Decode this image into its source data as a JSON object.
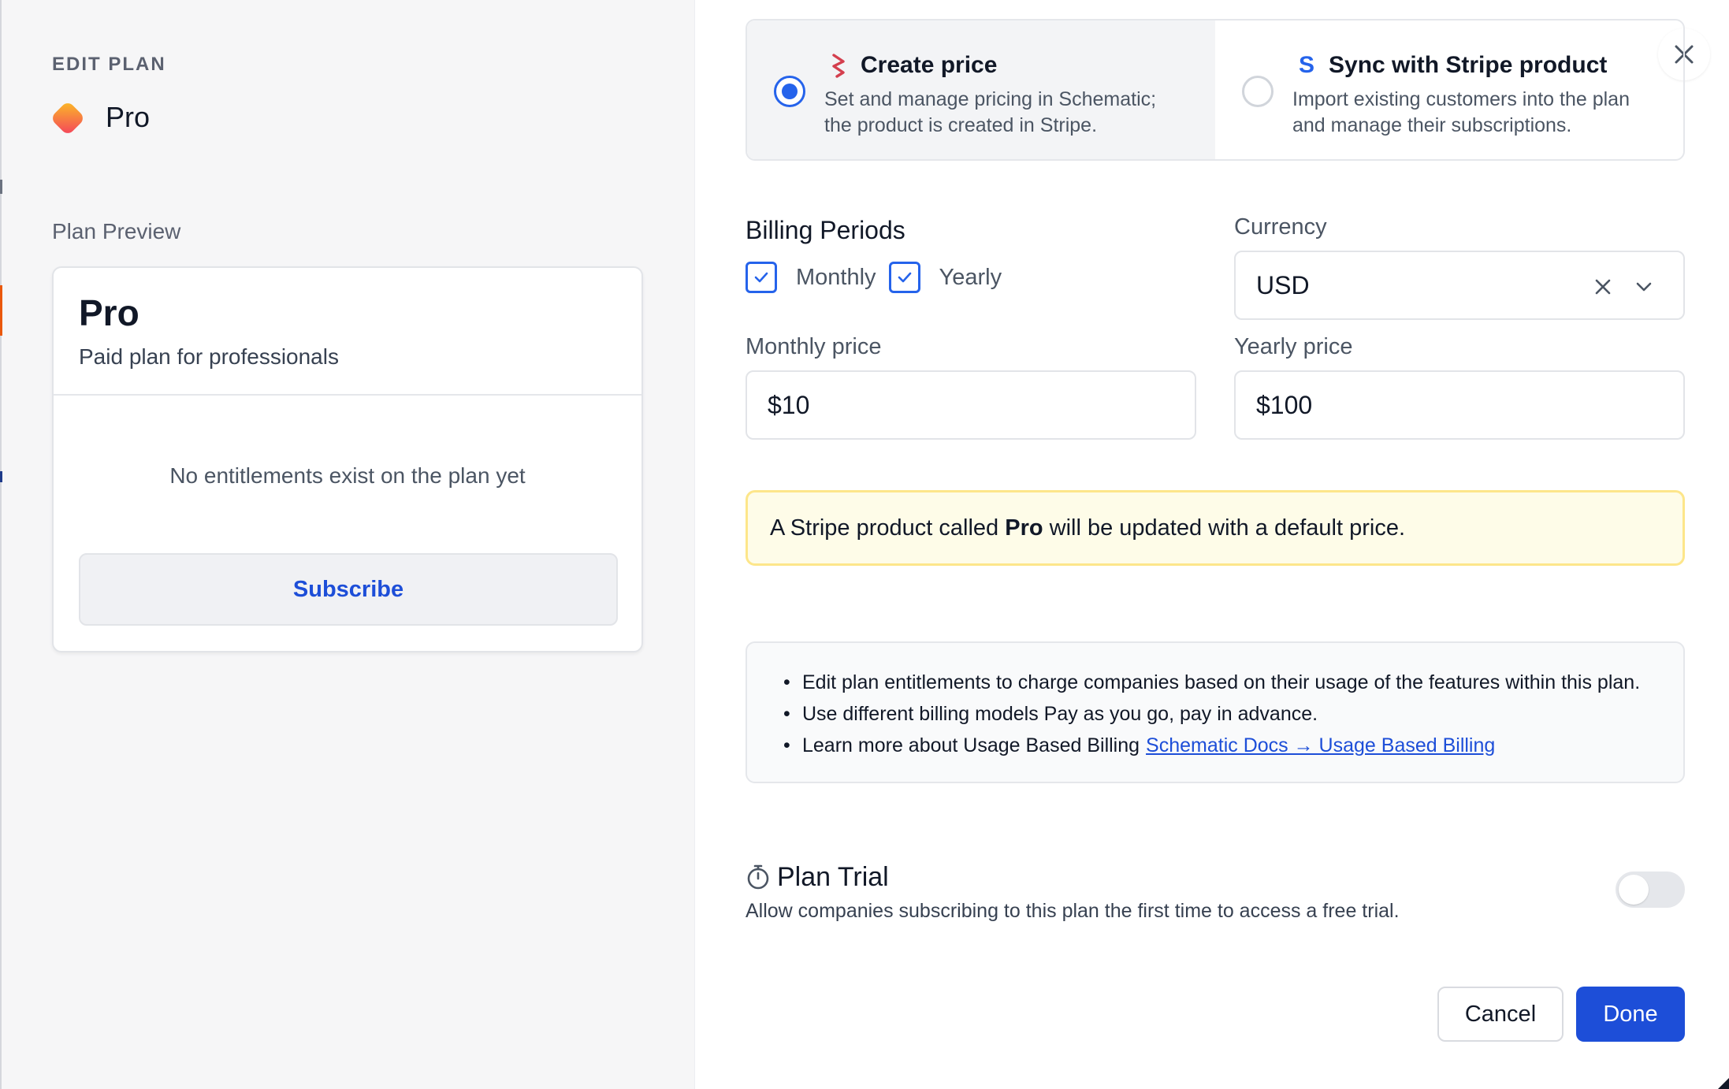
{
  "colors": {
    "accent": "#1d4ed8",
    "radio_selected": "#2563eb",
    "notice_bg": "#fefce8",
    "notice_border": "#fde68a",
    "left_panel_bg": "#f6f6f7",
    "stripe_icon": "#d43f4e",
    "sync_icon": "#2563eb"
  },
  "sidebar": {
    "header": "EDIT PLAN",
    "plan_name": "Pro",
    "plan_icon": "orange-gradient-rounded-square-icon",
    "preview_label": "Plan Preview",
    "preview_card": {
      "title": "Pro",
      "subtitle": "Paid plan for professionals",
      "empty_text": "No entitlements exist on the plan yet",
      "button_label": "Subscribe"
    }
  },
  "close_icon": "close-icon",
  "price_mode": {
    "options": [
      {
        "title": "Create price",
        "description_line1": "Set and manage pricing in Schematic;",
        "description_line2": "the product is created in Stripe.",
        "icon": "stripe-stripes-icon",
        "selected": true
      },
      {
        "title": "Sync with Stripe product",
        "description_line1": "Import existing customers into the plan",
        "description_line2": "and manage their subscriptions.",
        "icon": "stripe-s-icon",
        "selected": false
      }
    ]
  },
  "billing": {
    "label": "Billing Periods",
    "periods": [
      {
        "label": "Monthly",
        "checked": true
      },
      {
        "label": "Yearly",
        "checked": true
      }
    ]
  },
  "currency": {
    "label": "Currency",
    "value": "USD",
    "clear_icon": "x-icon",
    "caret_icon": "chevron-down-icon"
  },
  "prices": {
    "monthly_label": "Monthly price",
    "monthly_value": "$10",
    "yearly_label": "Yearly price",
    "yearly_value": "$100"
  },
  "notice": {
    "prefix": "A Stripe product called ",
    "product": "Pro",
    "suffix": " will be updated with a default price."
  },
  "info": {
    "item1": "Edit plan entitlements to charge companies based on their usage of the features within this plan.",
    "item2": "Use different billing models Pay as you go, pay in advance.",
    "item3": "Learn more about Usage Based Billing",
    "link_text": "Schematic Docs → Usage Based Billing"
  },
  "trial": {
    "icon": "stopwatch-icon",
    "title": "Plan Trial",
    "description": "Allow companies subscribing to this plan the first time to access a free trial.",
    "enabled": false
  },
  "footer": {
    "cancel_label": "Cancel",
    "done_label": "Done"
  }
}
